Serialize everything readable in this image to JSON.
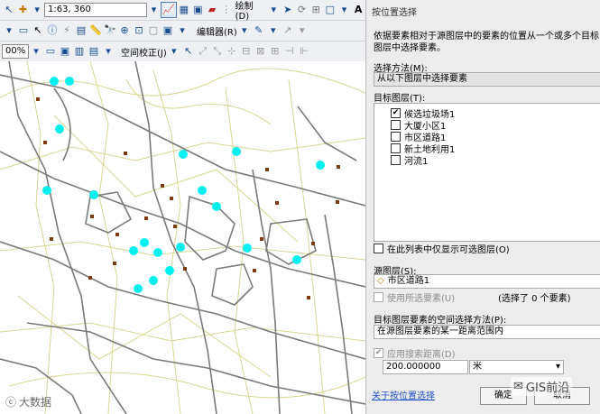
{
  "toolbar": {
    "scale": "1:63, 360",
    "draw_menu": "绘制(D)",
    "editor_menu": "编辑器(R)",
    "zoom_value": "00%",
    "spatial_adjust_menu": "空间校正(J)"
  },
  "dialog": {
    "title": "按位置选择",
    "description": "依据要素相对于源图层中的要素的位置从一个或多个目标图层中选择要素。",
    "method_label": "选择方法(M):",
    "method_value": "从以下图层中选择要素",
    "target_label": "目标图层(T):",
    "target_layers": [
      {
        "name": "候选垃圾场1",
        "checked": "✔"
      },
      {
        "name": "大厦小区1",
        "checked": ""
      },
      {
        "name": "市区道路1",
        "checked": ""
      },
      {
        "name": "新土地利用1",
        "checked": ""
      },
      {
        "name": "河流1",
        "checked": ""
      }
    ],
    "only_selectable_label": "在此列表中仅显示可选图层(O)",
    "source_label": "源图层(S):",
    "source_value": "市区道路1",
    "use_selected_label": "使用所选要素(U)",
    "selected_count": "(选择了 0 个要素)",
    "spatial_method_label": "目标图层要素的空间选择方法(P):",
    "spatial_method_value": "在源图层要素的某一距离范围内",
    "apply_distance_label": "应用搜索距离(D)",
    "distance_value": "200.000000",
    "unit_value": "米",
    "help_link": "关于按位置选择",
    "ok_button": "确定",
    "cancel_button": "取消"
  },
  "watermark": {
    "left": "大数据",
    "right": "GIS前沿"
  }
}
